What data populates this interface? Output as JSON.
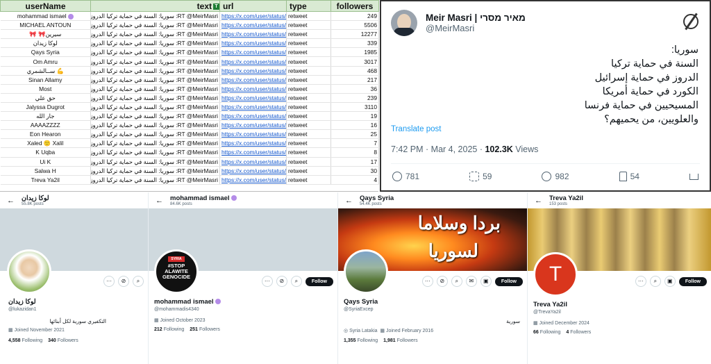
{
  "sheet": {
    "headers": {
      "username": "userName",
      "text": "text",
      "text_badge": "T",
      "url": "url",
      "type": "type",
      "followers": "followers"
    },
    "rows": [
      {
        "user": "mohammad ismael",
        "badge": true,
        "text": "RT @MeirMasri: سوريا: السنة في حماية تركيا الدروز في حماية",
        "url": "https://x.com/user/status/",
        "type": "retweet",
        "followers": "249"
      },
      {
        "user": "MICHAEL ANTOUN",
        "text": "RT @MeirMasri: سوريا: السنة في حماية تركيا الدروز في حماية",
        "url": "https://x.com/user/status/",
        "type": "retweet",
        "followers": "5506"
      },
      {
        "user": "🎀 🎀سيرين",
        "text": "RT @MeirMasri: سوريا: السنة في حماية تركيا الدروز في حماية",
        "url": "https://x.com/user/status/",
        "type": "retweet",
        "followers": "12277"
      },
      {
        "user": "لوكا زيدان",
        "text": "RT @MeirMasri: سوريا: السنة في حماية تركيا الدروز في حماية",
        "url": "https://x.com/user/status/",
        "type": "retweet",
        "followers": "339"
      },
      {
        "user": "Qays Syria",
        "text": "RT @MeirMasri: سوريا: السنة في حماية تركيا الدروز في حماية",
        "url": "https://x.com/user/status/",
        "type": "retweet",
        "followers": "1985"
      },
      {
        "user": "Om Amru",
        "text": "RT @MeirMasri: سوريا: السنة في حماية تركيا الدروز في حماية",
        "url": "https://x.com/user/status/",
        "type": "retweet",
        "followers": "3017"
      },
      {
        "user": "ســالشمري 💪",
        "text": "RT @MeirMasri: سوريا: السنة في حماية تركيا الدروز في حماية",
        "url": "https://x.com/user/status/",
        "type": "retweet",
        "followers": "468"
      },
      {
        "user": "Sinan Allamy",
        "text": "RT @MeirMasri: سوريا: السنة في حماية تركيا الدروز في حماية",
        "url": "https://x.com/user/status/",
        "type": "retweet",
        "followers": "217"
      },
      {
        "user": "Most",
        "text": "RT @MeirMasri: سوريا: السنة في حماية تركيا الدروز في حماية",
        "url": "https://x.com/user/status/",
        "type": "retweet",
        "followers": "36"
      },
      {
        "user": "حق علي",
        "text": "RT @MeirMasri: سوريا: السنة في حماية تركيا الدروز في حماية",
        "url": "https://x.com/user/status/",
        "type": "retweet",
        "followers": "239"
      },
      {
        "user": "Jalyssa Dugrot",
        "text": "RT @MeirMasri: سوريا: السنة في حماية تركيا الدروز في حماية",
        "url": "https://x.com/user/status/",
        "type": "retweet",
        "followers": "3110"
      },
      {
        "user": "جار الله",
        "text": "RT @MeirMasri: سوريا: السنة في حماية تركيا الدروز في حماية",
        "url": "https://x.com/user/status/",
        "type": "retweet",
        "followers": "19"
      },
      {
        "user": "AAAAZZZZ",
        "text": "RT @MeirMasri: سوريا: السنة في حماية تركيا الدروز في حماية",
        "url": "https://x.com/user/status/",
        "type": "retweet",
        "followers": "16"
      },
      {
        "user": "Eon Hearon",
        "text": "RT @MeirMasri: سوريا: السنة في حماية تركيا الدروز في حماية",
        "url": "https://x.com/user/status/",
        "type": "retweet",
        "followers": "25"
      },
      {
        "user": "Xaled 🙂 Xalil",
        "text": "RT @MeirMasri: سوريا: السنة في حماية تركيا الدروز في حماية",
        "url": "https://x.com/user/status/",
        "type": "retweet",
        "followers": "7"
      },
      {
        "user": "K Uqba",
        "text": "RT @MeirMasri: سوريا: السنة في حماية تركيا الدروز في حماية",
        "url": "https://x.com/user/status/",
        "type": "retweet",
        "followers": "8"
      },
      {
        "user": "Ui K",
        "text": "RT @MeirMasri: سوريا: السنة في حماية تركيا الدروز في حماية",
        "url": "https://x.com/user/status/",
        "type": "retweet",
        "followers": "17"
      },
      {
        "user": "Salwa H",
        "text": "RT @MeirMasri: سوريا: السنة في حماية تركيا الدروز في حماية",
        "url": "https://x.com/user/status/",
        "type": "retweet",
        "followers": "30"
      },
      {
        "user": "Treva Ya2il",
        "text": "RT @MeirMasri: سوريا: السنة في حماية تركيا الدروز في حماية",
        "url": "https://x.com/user/status/",
        "type": "retweet",
        "followers": "4"
      }
    ]
  },
  "tweet": {
    "name": "Meir Masri | מאיר מסרי",
    "handle": "@MeirMasri",
    "text": "سوريا:\nالسنة في حماية تركيا\nالدروز في حماية إسرائيل\nالكورد في حماية أمريكا\nالمسيحيين في حماية فرنسا\nوالعلويين، من يحميهم؟",
    "translate": "Translate post",
    "time": "7:42 PM · Mar 4, 2025 · ",
    "views": "102.3K",
    "views_label": " Views",
    "replies": "781",
    "retweets": "59",
    "likes": "982",
    "bookmarks": "54"
  },
  "profiles": [
    {
      "title": "لوكا زيدان",
      "posts": "55.8K posts",
      "name": "لوكا زيدان",
      "handle": "@lukazidan1",
      "bio": "التكفيري سورية لكل أبنائها",
      "joined": "Joined November 2021",
      "following": "4,558",
      "following_label": "Following",
      "followers": "340",
      "followers_label": "Followers"
    },
    {
      "title": "mohammad ismael",
      "posts": "84.6K posts",
      "name": "mohammad ismael",
      "handle": "@mohammadis4340",
      "joined": "Joined October 2023",
      "following": "212",
      "following_label": "Following",
      "followers": "251",
      "followers_label": "Followers",
      "follow": "Follow",
      "avatar_text": "#STOP ALAWITE GENOCIDE",
      "avatar_badge": "SYRIA"
    },
    {
      "title": "Qays Syria",
      "posts": "54.4K posts",
      "name": "Qays Syria",
      "handle": "@SyriaExcep",
      "bio": "سورية",
      "location": "Syria Latakia",
      "joined": "Joined February 2016",
      "following": "1,355",
      "following_label": "Following",
      "followers": "1,981",
      "followers_label": "Followers",
      "follow": "Follow",
      "banner_text1": "بردا وسلاما",
      "banner_text2": "لسوريا"
    },
    {
      "title": "Treva Ya2il",
      "posts": "153 posts",
      "name": "Treva Ya2il",
      "handle": "@TrevaYa2il",
      "joined": "Joined December 2024",
      "following": "66",
      "following_label": "Following",
      "followers": "4",
      "followers_label": "Followers",
      "follow": "Follow",
      "avatar_letter": "T"
    }
  ]
}
